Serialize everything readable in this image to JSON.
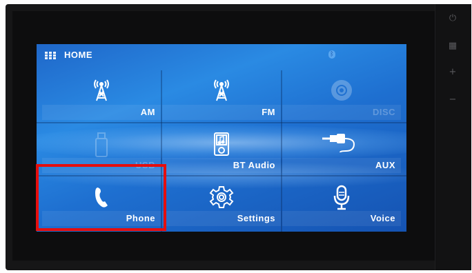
{
  "header": {
    "title": "HOME",
    "menu_icon": "grid-menu-icon",
    "status_icon": "bluetooth-icon",
    "status_glyph": "ᛒ"
  },
  "side_panel": {
    "buttons": [
      {
        "name": "power-icon",
        "glyph": "⏻"
      },
      {
        "name": "grid-menu-icon",
        "glyph": "▦"
      },
      {
        "name": "volume-up-icon",
        "glyph": "+"
      },
      {
        "name": "volume-down-icon",
        "glyph": "−"
      }
    ]
  },
  "tiles": [
    {
      "label": "AM",
      "icon": "radio-tower-icon",
      "enabled": true
    },
    {
      "label": "FM",
      "icon": "radio-tower-icon",
      "enabled": true
    },
    {
      "label": "DISC",
      "icon": "disc-icon",
      "enabled": false
    },
    {
      "label": "USB",
      "icon": "usb-drive-icon",
      "enabled": false
    },
    {
      "label": "BT Audio",
      "icon": "music-note-icon",
      "enabled": true
    },
    {
      "label": "AUX",
      "icon": "aux-cable-icon",
      "enabled": true
    },
    {
      "label": "Phone",
      "icon": "phone-icon",
      "enabled": true,
      "highlighted": true
    },
    {
      "label": "Settings",
      "icon": "gear-icon",
      "enabled": true
    },
    {
      "label": "Voice",
      "icon": "microphone-icon",
      "enabled": true
    }
  ],
  "colors": {
    "screen_blue": "#2a8ae3",
    "highlight_red": "#e50e0e"
  }
}
